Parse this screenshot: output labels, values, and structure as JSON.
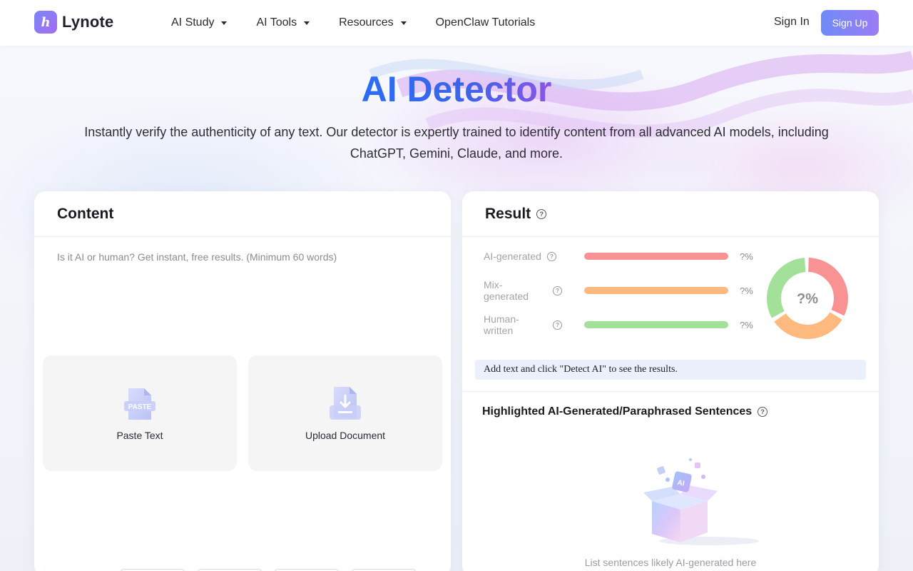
{
  "brand": {
    "name": "Lynote",
    "mark_letter": "h"
  },
  "nav": {
    "items": [
      {
        "label": "AI Study",
        "has_dropdown": true
      },
      {
        "label": "AI Tools",
        "has_dropdown": true
      },
      {
        "label": "Resources",
        "has_dropdown": true
      },
      {
        "label": "OpenClaw Tutorials",
        "has_dropdown": false
      }
    ],
    "sign_in": "Sign In",
    "sign_up": "Sign Up"
  },
  "hero": {
    "title": "AI Detector",
    "subtitle": "Instantly verify the authenticity of any text. Our detector is expertly trained to identify content from all advanced AI models, including ChatGPT, Gemini, Claude, and more."
  },
  "content_panel": {
    "title": "Content",
    "placeholder": "Is it AI or human? Get instant, free results. (Minimum 60 words)",
    "paste_label": "Paste Text",
    "paste_icon_text": "PASTE",
    "upload_label": "Upload Document"
  },
  "result_panel": {
    "title": "Result",
    "metrics": [
      {
        "label": "AI-generated",
        "value": "?%",
        "color": "#f99393"
      },
      {
        "label": "Mix-generated",
        "value": "?%",
        "color": "#fdb97e"
      },
      {
        "label": "Human-written",
        "value": "?%",
        "color": "#a3e19a"
      }
    ],
    "donut_value": "?%",
    "notice": "Add text and click \"Detect AI\" to see the results.",
    "highlight_title": "Highlighted AI-Generated/Paraphrased Sentences",
    "empty_text": "List sentences likely AI-generated here",
    "empty_art_badge": "AI"
  },
  "colors": {
    "accent_start": "#6f8bf7",
    "accent_end": "#9b7cf5",
    "ai": "#f99393",
    "mix": "#fdb97e",
    "human": "#a3e19a"
  }
}
